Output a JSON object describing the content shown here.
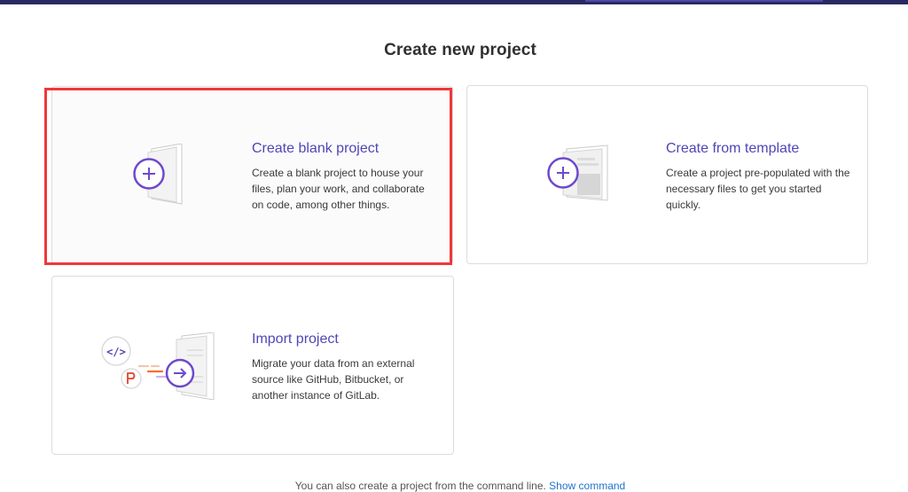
{
  "page": {
    "title": "Create new project"
  },
  "cards": {
    "blank": {
      "title": "Create blank project",
      "description": "Create a blank project to house your files, plan your work, and collaborate on code, among other things."
    },
    "template": {
      "title": "Create from template",
      "description": "Create a project pre-populated with the necessary files to get you started quickly."
    },
    "import": {
      "title": "Import project",
      "description": "Migrate your data from an external source like GitHub, Bitbucket, or another instance of GitLab."
    }
  },
  "footer": {
    "text": "You can also create a project from the command line.",
    "link": "Show command"
  },
  "colors": {
    "accent": "#6e49cb",
    "link": "#1f75cb",
    "highlight": "#f0373a",
    "topbar": "#292961"
  }
}
